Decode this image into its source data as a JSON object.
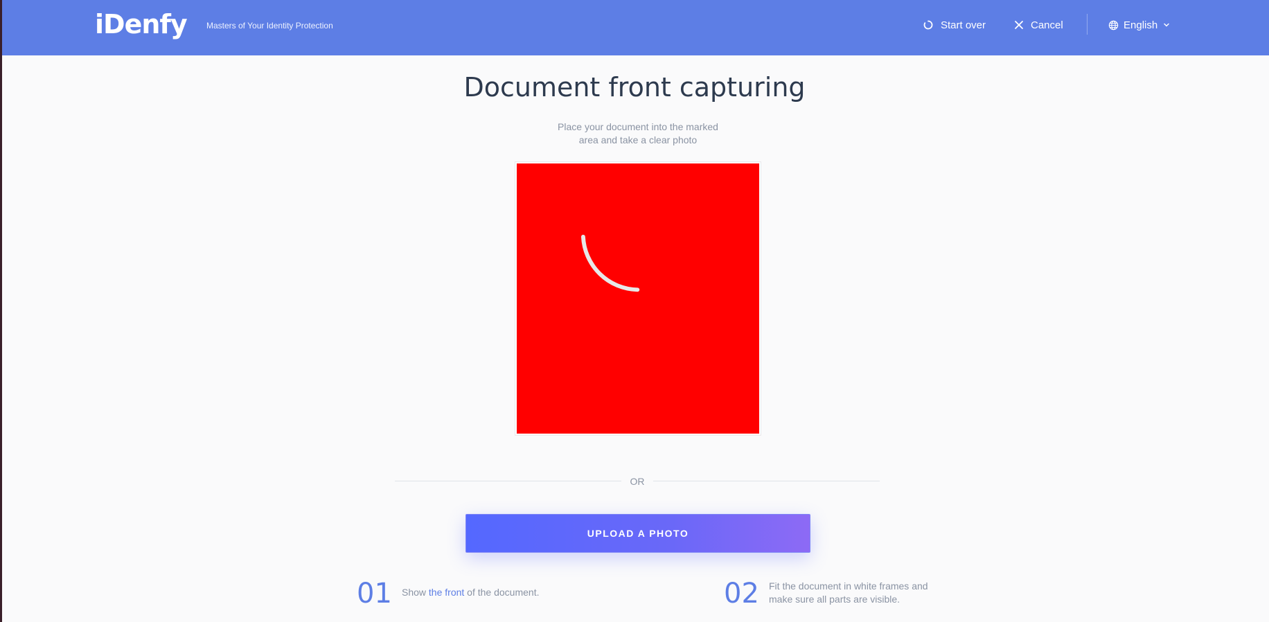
{
  "header": {
    "logo_text": "iDenfy",
    "tagline": "Masters of Your Identity Protection",
    "start_over_label": "Start over",
    "cancel_label": "Cancel",
    "language_label": "English",
    "background_color": "#5d7ee5"
  },
  "main": {
    "title": "Document front capturing",
    "subtitle_line1": "Place your document into the marked",
    "subtitle_line2": "area and take a clear photo",
    "capture_area_color": "#ff0000",
    "or_label": "OR",
    "upload_label": "UPLOAD A PHOTO"
  },
  "steps": [
    {
      "number": "01",
      "text_before": "Show ",
      "highlight": "the front",
      "text_after": " of the document."
    },
    {
      "number": "02",
      "text_line1": "Fit the document in white frames and",
      "text_line2": "make sure all parts are visible."
    }
  ],
  "icons": [
    "refresh-icon",
    "close-icon",
    "globe-icon",
    "chevron-down-icon",
    "loading-spinner-icon"
  ]
}
